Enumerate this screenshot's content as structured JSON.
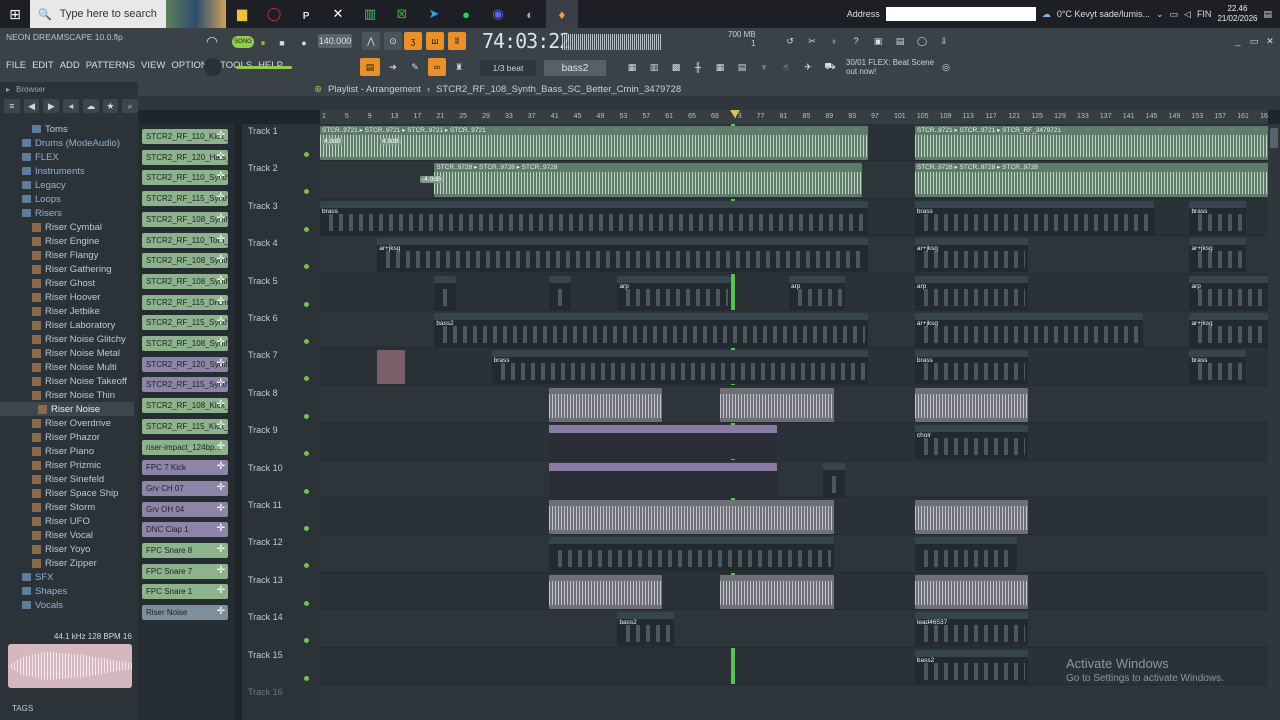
{
  "taskbar": {
    "search_placeholder": "Type here to search",
    "address_label": "Address",
    "weather": "0°C  Kevyt sade/lumis...",
    "lang": "FIN",
    "time": "22.46",
    "date": "21/02/2026"
  },
  "fl": {
    "project_title": "NEON DREAMSCAPE 10.0.flp",
    "song_mode": "SONG",
    "tempo": "140.000",
    "time_display": "74:03:22",
    "memory": "700 MB",
    "memory_sub": "1",
    "cpu_sub": "6",
    "menu": [
      "FILE",
      "EDIT",
      "ADD",
      "PATTERNS",
      "VIEW",
      "OPTIONS",
      "TOOLS",
      "HELP"
    ],
    "snap": "1/3 beat",
    "pattern": "bass2",
    "hint_line1": "30/01  FLEX: Beat Scene",
    "hint_line2": "out now!",
    "colors": {
      "accent": "#e9902a",
      "playhead": "#5fcf5a"
    }
  },
  "browser": {
    "title": "Browser",
    "items": [
      {
        "label": "Toms",
        "type": "folder",
        "level": 1
      },
      {
        "label": "Drums (ModeAudio)",
        "type": "folder",
        "level": 0
      },
      {
        "label": "FLEX",
        "type": "folder",
        "level": 0
      },
      {
        "label": "Instruments",
        "type": "folder",
        "level": 0
      },
      {
        "label": "Legacy",
        "type": "folder",
        "level": 0
      },
      {
        "label": "Loops",
        "type": "folder",
        "level": 0
      },
      {
        "label": "Risers",
        "type": "folder",
        "level": 0
      },
      {
        "label": "Riser Cymbal",
        "type": "audio",
        "level": 1
      },
      {
        "label": "Riser Engine",
        "type": "audio",
        "level": 1
      },
      {
        "label": "Riser Flangy",
        "type": "audio",
        "level": 1
      },
      {
        "label": "Riser Gathering",
        "type": "audio",
        "level": 1
      },
      {
        "label": "Riser Ghost",
        "type": "audio",
        "level": 1
      },
      {
        "label": "Riser Hoover",
        "type": "audio",
        "level": 1
      },
      {
        "label": "Riser Jetbike",
        "type": "audio",
        "level": 1
      },
      {
        "label": "Riser Laboratory",
        "type": "audio",
        "level": 1
      },
      {
        "label": "Riser Noise Glitchy",
        "type": "audio",
        "level": 1
      },
      {
        "label": "Riser Noise Metal",
        "type": "audio",
        "level": 1
      },
      {
        "label": "Riser Noise Multi",
        "type": "audio",
        "level": 1
      },
      {
        "label": "Riser Noise Takeoff",
        "type": "audio",
        "level": 1
      },
      {
        "label": "Riser Noise Thin",
        "type": "audio",
        "level": 1
      },
      {
        "label": "Riser Noise",
        "type": "audio",
        "level": 2,
        "selected": true
      },
      {
        "label": "Riser Overdrive",
        "type": "audio",
        "level": 1
      },
      {
        "label": "Riser Phazor",
        "type": "audio",
        "level": 1
      },
      {
        "label": "Riser Piano",
        "type": "audio",
        "level": 1
      },
      {
        "label": "Riser Prizmic",
        "type": "audio",
        "level": 1
      },
      {
        "label": "Riser Sinefeld",
        "type": "audio",
        "level": 1
      },
      {
        "label": "Riser Space Ship",
        "type": "audio",
        "level": 1
      },
      {
        "label": "Riser Storm",
        "type": "audio",
        "level": 1
      },
      {
        "label": "Riser UFO",
        "type": "audio",
        "level": 1
      },
      {
        "label": "Riser Vocal",
        "type": "audio",
        "level": 1
      },
      {
        "label": "Riser Yoyo",
        "type": "audio",
        "level": 1
      },
      {
        "label": "Riser Zipper",
        "type": "audio",
        "level": 1
      },
      {
        "label": "SFX",
        "type": "folder",
        "level": 0
      },
      {
        "label": "Shapes",
        "type": "folder",
        "level": 0
      },
      {
        "label": "Vocals",
        "type": "folder",
        "level": 0
      }
    ],
    "sample_info": "44.1 kHz 128 BPM 16",
    "tags_label": "TAGS"
  },
  "channels": [
    {
      "label": "STCR2_RF_110_Kick_...",
      "color": "green"
    },
    {
      "label": "STCR2_RF_120_Hats_...",
      "color": "green"
    },
    {
      "label": "STCR2_RF_110_Synth_...",
      "color": "green"
    },
    {
      "label": "STCR2_RF_115_Synth_...",
      "color": "green"
    },
    {
      "label": "STCR2_RF_108_Synth_...",
      "color": "green"
    },
    {
      "label": "STCR2_RF_110_Tom_...",
      "color": "green"
    },
    {
      "label": "STCR2_RF_108_Synth_...",
      "color": "green"
    },
    {
      "label": "STCR2_RF_108_Synth_...",
      "color": "green"
    },
    {
      "label": "STCR2_RF_115_Drum_...",
      "color": "green"
    },
    {
      "label": "STCR2_RF_115_Synth_...",
      "color": "green"
    },
    {
      "label": "STCR2_RF_108_Synth_...",
      "color": "green"
    },
    {
      "label": "STCR2_RF_120_Synth_...",
      "color": "purple"
    },
    {
      "label": "STCR2_RF_115_Synth_...",
      "color": "purple"
    },
    {
      "label": "STCR2_RF_108_Kick_...",
      "color": "green"
    },
    {
      "label": "STCR2_RF_115_Kick_...",
      "color": "green"
    },
    {
      "label": "riser-impact_124bp...",
      "color": "green"
    },
    {
      "label": "FPC 7 Kick",
      "color": "purple"
    },
    {
      "label": "Grv CH 07",
      "color": "purple"
    },
    {
      "label": "Grv OH 04",
      "color": "purple"
    },
    {
      "label": "DNC Clap 1",
      "color": "purple"
    },
    {
      "label": "FPC Snare 8",
      "color": "green"
    },
    {
      "label": "FPC Snare 7",
      "color": "green"
    },
    {
      "label": "FPC Snare 1",
      "color": "green"
    },
    {
      "label": "Riser Noise",
      "color": "slate"
    }
  ],
  "playlist": {
    "title": "Playlist - Arrangement",
    "current_clip": "STCR2_RF_108_Synth_Bass_SC_Better_Cmin_3479728",
    "ruler": [
      "1",
      "5",
      "9",
      "13",
      "17",
      "21",
      "25",
      "29",
      "33",
      "37",
      "41",
      "45",
      "49",
      "53",
      "57",
      "61",
      "65",
      "69",
      "73",
      "77",
      "81",
      "85",
      "89",
      "93",
      "97",
      "101",
      "105",
      "109",
      "113",
      "117",
      "121",
      "125",
      "129",
      "133",
      "137",
      "141",
      "145",
      "149",
      "153",
      "157",
      "161",
      "165"
    ],
    "tracks": [
      "Track 1",
      "Track 2",
      "Track 3",
      "Track 4",
      "Track 5",
      "Track 6",
      "Track 7",
      "Track 8",
      "Track 9",
      "Track 10",
      "Track 11",
      "Track 12",
      "Track 13",
      "Track 14",
      "Track 15",
      "Track 16"
    ],
    "clips": [
      {
        "track": 1,
        "start": 1,
        "length": 96,
        "kind": "audio",
        "label": "STCR..9721 ▸ STCR..9721 ▸ STCR..9721 ▸ STCR..9721"
      },
      {
        "track": 1,
        "start": 105,
        "length": 84,
        "kind": "audio",
        "label": "STCR..9721 ▸ STCR..9721 ▸ STCR_RF_3479721"
      },
      {
        "track": 2,
        "start": 21,
        "length": 75,
        "kind": "audio",
        "label": "STCR..9728 ▸ STCR..9728 ▸ STCR..9728"
      },
      {
        "track": 2,
        "start": 105,
        "length": 70,
        "kind": "audio",
        "label": "STCR..9728 ▸ STCR..9728 ▸ STCR..9728"
      },
      {
        "track": 3,
        "start": 1,
        "length": 96,
        "kind": "pattern",
        "label": "brass"
      },
      {
        "track": 3,
        "start": 105,
        "length": 42,
        "kind": "pattern",
        "label": "brass"
      },
      {
        "track": 3,
        "start": 153,
        "length": 10,
        "kind": "pattern",
        "label": "brass"
      },
      {
        "track": 4,
        "start": 11,
        "length": 86,
        "kind": "pattern",
        "label": "ar+jksg"
      },
      {
        "track": 4,
        "start": 105,
        "length": 20,
        "kind": "pattern",
        "label": "ar+jksg"
      },
      {
        "track": 4,
        "start": 153,
        "length": 10,
        "kind": "pattern",
        "label": "ar+jksg"
      },
      {
        "track": 5,
        "start": 21,
        "length": 4,
        "kind": "pattern",
        "label": ""
      },
      {
        "track": 5,
        "start": 41,
        "length": 4,
        "kind": "pattern",
        "label": ""
      },
      {
        "track": 5,
        "start": 53,
        "length": 20,
        "kind": "pattern",
        "label": "arp"
      },
      {
        "track": 5,
        "start": 83,
        "length": 10,
        "kind": "pattern",
        "label": "arp"
      },
      {
        "track": 5,
        "start": 105,
        "length": 20,
        "kind": "pattern",
        "label": "arp"
      },
      {
        "track": 5,
        "start": 153,
        "length": 30,
        "kind": "pattern",
        "label": "arp"
      },
      {
        "track": 6,
        "start": 21,
        "length": 76,
        "kind": "pattern",
        "label": "bass2"
      },
      {
        "track": 6,
        "start": 105,
        "length": 40,
        "kind": "pattern",
        "label": "ar+jksg"
      },
      {
        "track": 6,
        "start": 153,
        "length": 20,
        "kind": "pattern",
        "label": "ar+jksg"
      },
      {
        "track": 6,
        "start": 173,
        "length": 10,
        "kind": "red",
        "label": "STCR2_ume"
      },
      {
        "track": 7,
        "start": 11,
        "length": 5,
        "kind": "red",
        "label": ""
      },
      {
        "track": 7,
        "start": 31,
        "length": 66,
        "kind": "pattern",
        "label": "brass"
      },
      {
        "track": 7,
        "start": 105,
        "length": 20,
        "kind": "pattern",
        "label": "brass"
      },
      {
        "track": 7,
        "start": 153,
        "length": 10,
        "kind": "pattern",
        "label": "brass"
      },
      {
        "track": 8,
        "start": 41,
        "length": 20,
        "kind": "drum",
        "label": ""
      },
      {
        "track": 8,
        "start": 71,
        "length": 20,
        "kind": "drum",
        "label": ""
      },
      {
        "track": 8,
        "start": 105,
        "length": 20,
        "kind": "drum",
        "label": ""
      },
      {
        "track": 9,
        "start": 41,
        "length": 40,
        "kind": "purple",
        "label": ""
      },
      {
        "track": 9,
        "start": 105,
        "length": 20,
        "kind": "pattern",
        "label": "choir"
      },
      {
        "track": 10,
        "start": 41,
        "length": 40,
        "kind": "purple",
        "label": ""
      },
      {
        "track": 10,
        "start": 89,
        "length": 4,
        "kind": "pattern",
        "label": ""
      },
      {
        "track": 11,
        "start": 41,
        "length": 50,
        "kind": "drum",
        "label": ""
      },
      {
        "track": 11,
        "start": 105,
        "length": 20,
        "kind": "drum",
        "label": ""
      },
      {
        "track": 12,
        "start": 41,
        "length": 50,
        "kind": "pattern",
        "label": ""
      },
      {
        "track": 12,
        "start": 105,
        "length": 18,
        "kind": "pattern",
        "label": ""
      },
      {
        "track": 13,
        "start": 41,
        "length": 20,
        "kind": "drum",
        "label": ""
      },
      {
        "track": 13,
        "start": 71,
        "length": 20,
        "kind": "drum",
        "label": ""
      },
      {
        "track": 13,
        "start": 105,
        "length": 20,
        "kind": "drum",
        "label": ""
      },
      {
        "track": 14,
        "start": 53,
        "length": 10,
        "kind": "pattern",
        "label": "bass2"
      },
      {
        "track": 14,
        "start": 105,
        "length": 20,
        "kind": "pattern",
        "label": "lead46537"
      },
      {
        "track": 15,
        "start": 105,
        "length": 20,
        "kind": "pattern",
        "label": "bass2"
      }
    ],
    "volume_labels": [
      "4.9dB",
      "4.9dB",
      "-4.0dB"
    ]
  },
  "activation": {
    "title": "Activate Windows",
    "subtitle": "Go to Settings to activate Windows."
  }
}
